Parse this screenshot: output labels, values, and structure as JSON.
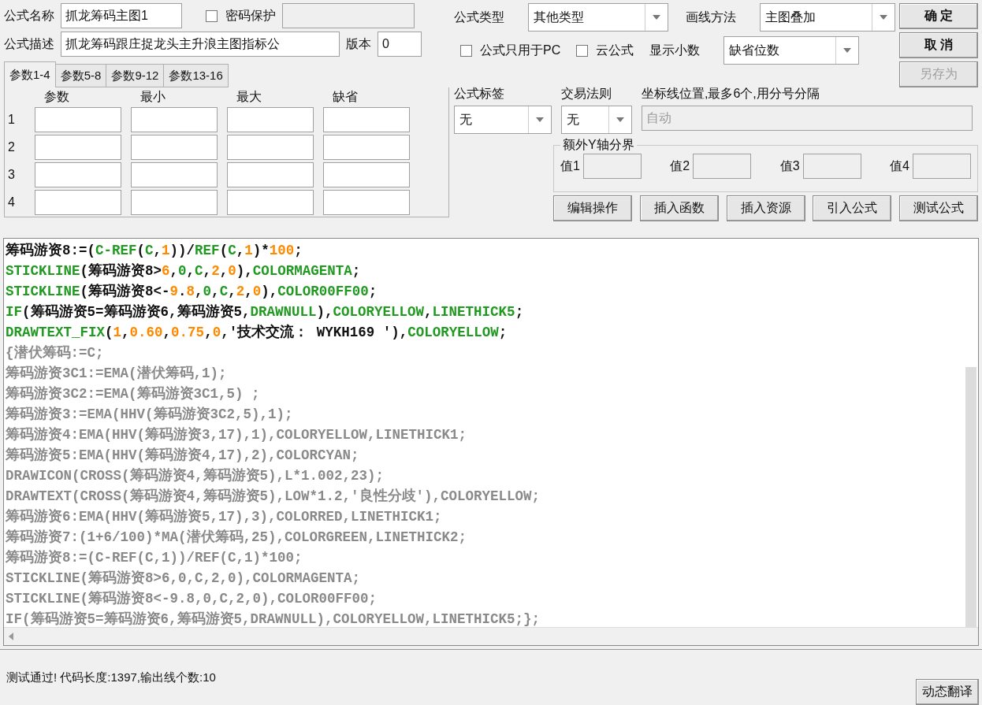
{
  "form": {
    "name_label": "公式名称",
    "name_value": "抓龙筹码主图1",
    "password": {
      "label": "密码保护",
      "checked": false
    },
    "desc_label": "公式描述",
    "desc_value": "抓龙筹码跟庄捉龙头主升浪主图指标公",
    "version_label": "版本",
    "version_value": "0"
  },
  "param_tabs": [
    {
      "label": "参数1-4",
      "selected": true
    },
    {
      "label": "参数5-8",
      "selected": false
    },
    {
      "label": "参数9-12",
      "selected": false
    },
    {
      "label": "参数13-16",
      "selected": false
    }
  ],
  "param_columns": [
    "参数",
    "最小",
    "最大",
    "缺省"
  ],
  "param_rows": [
    "1",
    "2",
    "3",
    "4"
  ],
  "formula_type": {
    "label": "公式类型",
    "value": "其他类型"
  },
  "draw_method": {
    "label": "画线方法",
    "value": "主图叠加"
  },
  "pc_only": {
    "label": "公式只用于PC",
    "checked": false
  },
  "cloud": {
    "label": "云公式",
    "checked": false
  },
  "decimals": {
    "label": "显示小数",
    "value": "缺省位数"
  },
  "tag": {
    "label": "公式标签",
    "value": "无"
  },
  "trade_rule": {
    "label": "交易法则",
    "value": "无"
  },
  "axis": {
    "label": "坐标线位置,最多6个,用分号分隔",
    "value": "自动",
    "disabled": true
  },
  "y_bounds": {
    "title": "额外Y轴分界",
    "values": [
      "值1",
      "值2",
      "值3",
      "值4"
    ]
  },
  "side_buttons": [
    {
      "label": "确 定",
      "disabled": false
    },
    {
      "label": "取 消",
      "disabled": false
    },
    {
      "label": "另存为",
      "disabled": true
    }
  ],
  "tool_buttons": [
    "编辑操作",
    "插入函数",
    "插入资源",
    "引入公式",
    "测试公式"
  ],
  "code_lines": [
    [
      {
        "kind": "plain",
        "text": "筹码游资8:=("
      },
      {
        "kind": "func",
        "text": "C-REF"
      },
      {
        "kind": "plain",
        "text": "("
      },
      {
        "kind": "func",
        "text": "C"
      },
      {
        "kind": "plain",
        "text": ","
      },
      {
        "kind": "num",
        "text": "1"
      },
      {
        "kind": "plain",
        "text": "))/"
      },
      {
        "kind": "func",
        "text": "REF"
      },
      {
        "kind": "plain",
        "text": "("
      },
      {
        "kind": "func",
        "text": "C"
      },
      {
        "kind": "plain",
        "text": ","
      },
      {
        "kind": "num",
        "text": "1"
      },
      {
        "kind": "plain",
        "text": ")*"
      },
      {
        "kind": "num",
        "text": "100"
      },
      {
        "kind": "plain",
        "text": ";"
      }
    ],
    [
      {
        "kind": "func",
        "text": "STICKLINE"
      },
      {
        "kind": "plain",
        "text": "(筹码游资8>"
      },
      {
        "kind": "num",
        "text": "6"
      },
      {
        "kind": "plain",
        "text": ","
      },
      {
        "kind": "func",
        "text": "0"
      },
      {
        "kind": "plain",
        "text": ","
      },
      {
        "kind": "func",
        "text": "C"
      },
      {
        "kind": "plain",
        "text": ","
      },
      {
        "kind": "num",
        "text": "2"
      },
      {
        "kind": "plain",
        "text": ","
      },
      {
        "kind": "num",
        "text": "0"
      },
      {
        "kind": "plain",
        "text": "),"
      },
      {
        "kind": "func",
        "text": "COLORMAGENTA"
      },
      {
        "kind": "plain",
        "text": ";"
      }
    ],
    [
      {
        "kind": "func",
        "text": "STICKLINE"
      },
      {
        "kind": "plain",
        "text": "(筹码游资8<-"
      },
      {
        "kind": "num",
        "text": "9"
      },
      {
        "kind": "plain",
        "text": "."
      },
      {
        "kind": "num",
        "text": "8"
      },
      {
        "kind": "plain",
        "text": ","
      },
      {
        "kind": "func",
        "text": "0"
      },
      {
        "kind": "plain",
        "text": ","
      },
      {
        "kind": "func",
        "text": "C"
      },
      {
        "kind": "plain",
        "text": ","
      },
      {
        "kind": "num",
        "text": "2"
      },
      {
        "kind": "plain",
        "text": ","
      },
      {
        "kind": "num",
        "text": "0"
      },
      {
        "kind": "plain",
        "text": "),"
      },
      {
        "kind": "func",
        "text": "COLOR00FF00"
      },
      {
        "kind": "plain",
        "text": ";"
      }
    ],
    [
      {
        "kind": "func",
        "text": "IF"
      },
      {
        "kind": "plain",
        "text": "(筹码游资5=筹码游资6,筹码游资5,"
      },
      {
        "kind": "func",
        "text": "DRAWNULL"
      },
      {
        "kind": "plain",
        "text": "),"
      },
      {
        "kind": "func",
        "text": "COLORYELLOW"
      },
      {
        "kind": "plain",
        "text": ","
      },
      {
        "kind": "func",
        "text": "LINETHICK5"
      },
      {
        "kind": "plain",
        "text": ";"
      }
    ],
    [
      {
        "kind": "func",
        "text": "DRAWTEXT_FIX"
      },
      {
        "kind": "plain",
        "text": "("
      },
      {
        "kind": "num",
        "text": "1"
      },
      {
        "kind": "plain",
        "text": ","
      },
      {
        "kind": "num",
        "text": "0.60"
      },
      {
        "kind": "plain",
        "text": ","
      },
      {
        "kind": "num",
        "text": "0.75"
      },
      {
        "kind": "plain",
        "text": ","
      },
      {
        "kind": "num",
        "text": "0"
      },
      {
        "kind": "plain",
        "text": ",'技术交流： WYKH169 '),"
      },
      {
        "kind": "func",
        "text": "COLORYELLOW"
      },
      {
        "kind": "plain",
        "text": ";"
      }
    ],
    [
      {
        "kind": "comment",
        "text": "{潜伏筹码:=C;"
      }
    ],
    [
      {
        "kind": "comment",
        "text": "筹码游资3C1:=EMA(潜伏筹码,1);"
      }
    ],
    [
      {
        "kind": "comment",
        "text": "筹码游资3C2:=EMA(筹码游资3C1,5) ;"
      }
    ],
    [
      {
        "kind": "comment",
        "text": "筹码游资3:=EMA(HHV(筹码游资3C2,5),1);"
      }
    ],
    [
      {
        "kind": "comment",
        "text": "筹码游资4:EMA(HHV(筹码游资3,17),1),COLORYELLOW,LINETHICK1;"
      }
    ],
    [
      {
        "kind": "comment",
        "text": "筹码游资5:EMA(HHV(筹码游资4,17),2),COLORCYAN;"
      }
    ],
    [
      {
        "kind": "comment",
        "text": "DRAWICON(CROSS(筹码游资4,筹码游资5),L*1.002,23);"
      }
    ],
    [
      {
        "kind": "comment",
        "text": "DRAWTEXT(CROSS(筹码游资4,筹码游资5),LOW*1.2,'良性分歧'),COLORYELLOW;"
      }
    ],
    [
      {
        "kind": "comment",
        "text": "筹码游资6:EMA(HHV(筹码游资5,17),3),COLORRED,LINETHICK1;"
      }
    ],
    [
      {
        "kind": "comment",
        "text": "筹码游资7:(1+6/100)*MA(潜伏筹码,25),COLORGREEN,LINETHICK2;"
      }
    ],
    [
      {
        "kind": "comment",
        "text": "筹码游资8:=(C-REF(C,1))/REF(C,1)*100;"
      }
    ],
    [
      {
        "kind": "comment",
        "text": "STICKLINE(筹码游资8>6,0,C,2,0),COLORMAGENTA;"
      }
    ],
    [
      {
        "kind": "comment",
        "text": "STICKLINE(筹码游资8<-9.8,0,C,2,0),COLOR00FF00;"
      }
    ],
    [
      {
        "kind": "comment",
        "text": "IF(筹码游资5=筹码游资6,筹码游资5,DRAWNULL),COLORYELLOW,LINETHICK5;};"
      }
    ]
  ],
  "status": "测试通过! 代码长度:1397,输出线个数:10",
  "translate_button": "动态翻译"
}
